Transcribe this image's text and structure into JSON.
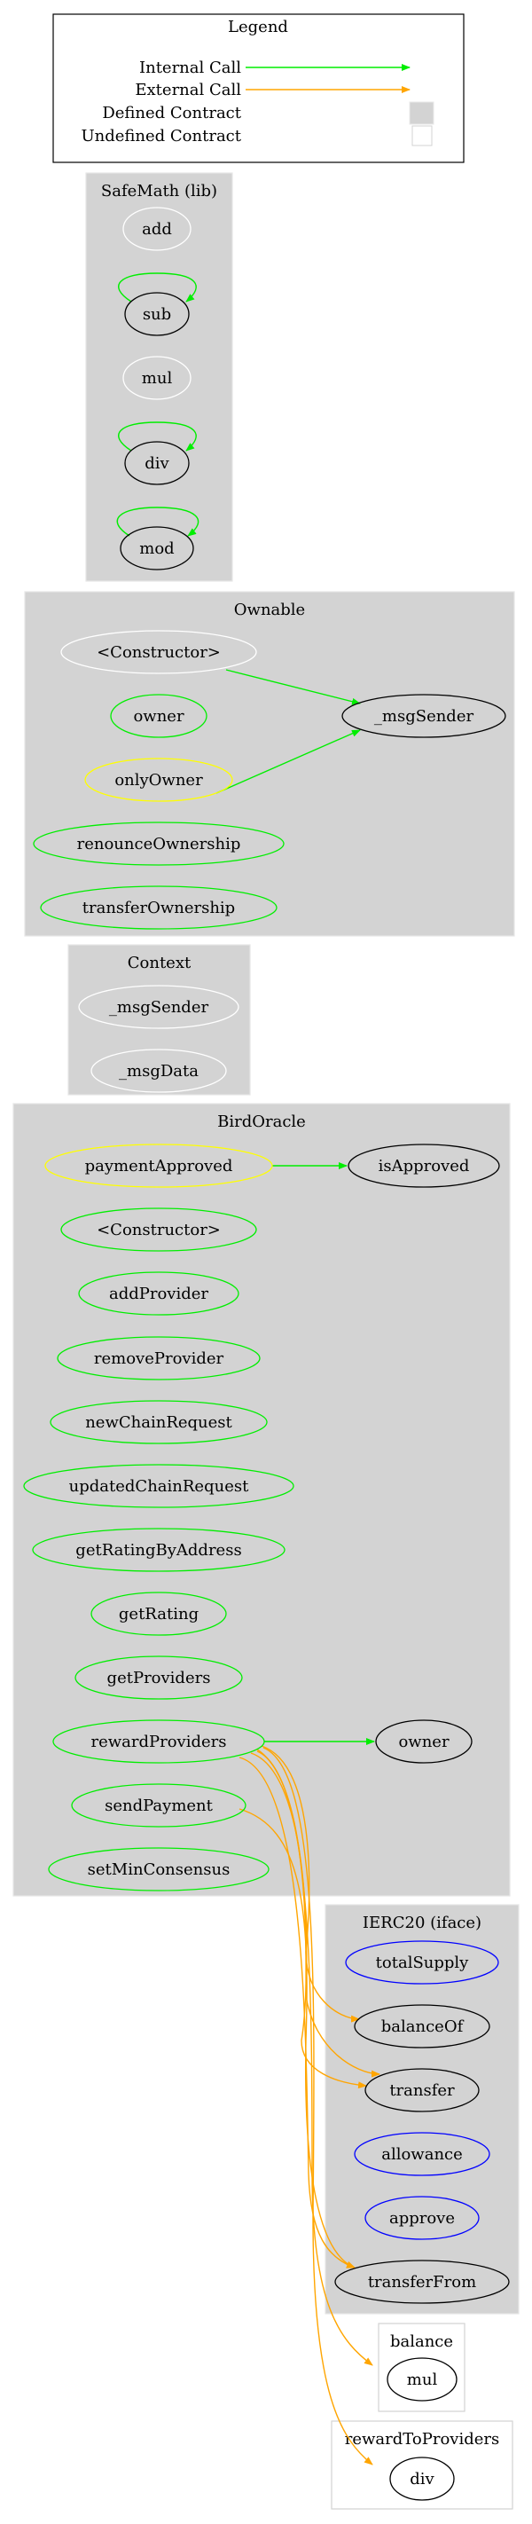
{
  "legend": {
    "title": "Legend",
    "rows": [
      {
        "label": "Internal Call",
        "kind": "internal"
      },
      {
        "label": "External Call",
        "kind": "external"
      },
      {
        "label": "Defined Contract",
        "kind": "defined"
      },
      {
        "label": "Undefined Contract",
        "kind": "undefined"
      }
    ]
  },
  "colors": {
    "internal_call": "#00ee00",
    "external_call": "#ffa500",
    "defined_cluster_fill": "#d3d3d3",
    "undefined_cluster_border": "#d3d3d3",
    "public_function": "#00ee00",
    "modifier": "#ffff00",
    "internal_function": "#ffffff",
    "interface_function": "#0000ff",
    "called_function": "#000000"
  },
  "clusters": [
    {
      "id": "safemath",
      "label": "SafeMath  (lib)",
      "defined": true,
      "nodes": [
        {
          "id": "sm_add",
          "label": "add",
          "role": "internal_function"
        },
        {
          "id": "sm_sub",
          "label": "sub",
          "role": "called_function"
        },
        {
          "id": "sm_mul",
          "label": "mul",
          "role": "internal_function"
        },
        {
          "id": "sm_div",
          "label": "div",
          "role": "called_function"
        },
        {
          "id": "sm_mod",
          "label": "mod",
          "role": "called_function"
        }
      ]
    },
    {
      "id": "ownable",
      "label": "Ownable",
      "defined": true,
      "nodes": [
        {
          "id": "ow_ctor",
          "label": "<Constructor>",
          "role": "internal_function"
        },
        {
          "id": "ow_owner",
          "label": "owner",
          "role": "public_function"
        },
        {
          "id": "ow_onlyOwner",
          "label": "onlyOwner",
          "role": "modifier"
        },
        {
          "id": "ow_renounce",
          "label": "renounceOwnership",
          "role": "public_function"
        },
        {
          "id": "ow_transferOwnership",
          "label": "transferOwnership",
          "role": "public_function"
        },
        {
          "id": "ow_msgSender",
          "label": "_msgSender",
          "role": "called_function"
        }
      ]
    },
    {
      "id": "context",
      "label": "Context",
      "defined": true,
      "nodes": [
        {
          "id": "cx_msgSender",
          "label": "_msgSender",
          "role": "internal_function"
        },
        {
          "id": "cx_msgData",
          "label": "_msgData",
          "role": "internal_function"
        }
      ]
    },
    {
      "id": "birdoracle",
      "label": "BirdOracle",
      "defined": true,
      "nodes": [
        {
          "id": "bo_paymentApproved",
          "label": "paymentApproved",
          "role": "modifier"
        },
        {
          "id": "bo_ctor",
          "label": "<Constructor>",
          "role": "public_function"
        },
        {
          "id": "bo_addProvider",
          "label": "addProvider",
          "role": "public_function"
        },
        {
          "id": "bo_removeProvider",
          "label": "removeProvider",
          "role": "public_function"
        },
        {
          "id": "bo_newChainRequest",
          "label": "newChainRequest",
          "role": "public_function"
        },
        {
          "id": "bo_updatedChainRequest",
          "label": "updatedChainRequest",
          "role": "public_function"
        },
        {
          "id": "bo_getRatingByAddress",
          "label": "getRatingByAddress",
          "role": "public_function"
        },
        {
          "id": "bo_getRating",
          "label": "getRating",
          "role": "public_function"
        },
        {
          "id": "bo_getProviders",
          "label": "getProviders",
          "role": "public_function"
        },
        {
          "id": "bo_rewardProviders",
          "label": "rewardProviders",
          "role": "public_function"
        },
        {
          "id": "bo_sendPayment",
          "label": "sendPayment",
          "role": "public_function"
        },
        {
          "id": "bo_setMinConsensus",
          "label": "setMinConsensus",
          "role": "public_function"
        },
        {
          "id": "bo_isApproved",
          "label": "isApproved",
          "role": "called_function"
        },
        {
          "id": "bo_owner",
          "label": "owner",
          "role": "called_function"
        }
      ]
    },
    {
      "id": "ierc20",
      "label": "IERC20  (iface)",
      "defined": true,
      "nodes": [
        {
          "id": "ie_totalSupply",
          "label": "totalSupply",
          "role": "interface_function"
        },
        {
          "id": "ie_balanceOf",
          "label": "balanceOf",
          "role": "called_function"
        },
        {
          "id": "ie_transfer",
          "label": "transfer",
          "role": "called_function"
        },
        {
          "id": "ie_allowance",
          "label": "allowance",
          "role": "interface_function"
        },
        {
          "id": "ie_approve",
          "label": "approve",
          "role": "interface_function"
        },
        {
          "id": "ie_transferFrom",
          "label": "transferFrom",
          "role": "called_function"
        }
      ]
    },
    {
      "id": "balance",
      "label": "balance",
      "defined": false,
      "nodes": [
        {
          "id": "ba_mul",
          "label": "mul",
          "role": "called_function"
        }
      ]
    },
    {
      "id": "rewardtoproviders",
      "label": "rewardToProviders",
      "defined": false,
      "nodes": [
        {
          "id": "rp_div",
          "label": "div",
          "role": "called_function"
        }
      ]
    }
  ],
  "edges": [
    {
      "from": "sm_sub",
      "to": "sm_sub",
      "kind": "internal"
    },
    {
      "from": "sm_div",
      "to": "sm_div",
      "kind": "internal"
    },
    {
      "from": "sm_mod",
      "to": "sm_mod",
      "kind": "internal"
    },
    {
      "from": "ow_ctor",
      "to": "ow_msgSender",
      "kind": "internal"
    },
    {
      "from": "ow_onlyOwner",
      "to": "ow_msgSender",
      "kind": "internal"
    },
    {
      "from": "bo_paymentApproved",
      "to": "bo_isApproved",
      "kind": "internal"
    },
    {
      "from": "bo_rewardProviders",
      "to": "bo_owner",
      "kind": "internal"
    },
    {
      "from": "bo_rewardProviders",
      "to": "ie_balanceOf",
      "kind": "external"
    },
    {
      "from": "bo_rewardProviders",
      "to": "ie_transfer",
      "kind": "external"
    },
    {
      "from": "bo_rewardProviders",
      "to": "ie_transfer",
      "kind": "external"
    },
    {
      "from": "bo_rewardProviders",
      "to": "ie_transferFrom",
      "kind": "external"
    },
    {
      "from": "bo_rewardProviders",
      "to": "ba_mul",
      "kind": "external"
    },
    {
      "from": "bo_rewardProviders",
      "to": "rp_div",
      "kind": "external"
    },
    {
      "from": "bo_sendPayment",
      "to": "ie_transferFrom",
      "kind": "external"
    }
  ]
}
